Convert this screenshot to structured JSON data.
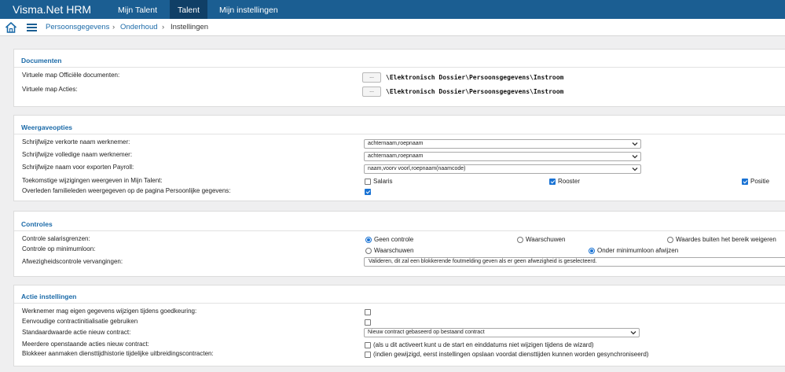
{
  "app": {
    "brand": "Visma.Net HRM",
    "nav_tabs": [
      {
        "label": "Mijn Talent",
        "active": false
      },
      {
        "label": "Talent",
        "active": true
      },
      {
        "label": "Mijn instellingen",
        "active": false
      }
    ],
    "accent_color": "#1b5e92"
  },
  "breadcrumb": {
    "items": [
      "Persoonsgegevens",
      "Onderhoud",
      "Instellingen"
    ],
    "separator": "›"
  },
  "documenten": {
    "title": "Documenten",
    "rows": [
      {
        "label": "Virtuele map Officiële documenten:",
        "button": "...",
        "path": "\\Elektronisch Dossier\\Persoonsgegevens\\Instroom"
      },
      {
        "label": "Virtuele map Acties:",
        "button": "...",
        "path": "\\Elektronisch Dossier\\Persoonsgegevens\\Instroom"
      }
    ]
  },
  "weergave": {
    "title": "Weergaveopties",
    "short_name": {
      "label": "Schrijfwijze verkorte naam werknemer:",
      "value": "achternaam,roepnaam"
    },
    "full_name": {
      "label": "Schrijfwijze volledige naam werknemer:",
      "value": "achternaam,roepnaam"
    },
    "payroll_name": {
      "label": "Schrijfwijze naam voor exporten Payroll:",
      "value": "naam,voorv voorl,roepnaam(naamcode)"
    },
    "future_changes": {
      "label": "Toekomstige wijzigingen weergeven in Mijn Talent:",
      "options": [
        {
          "label": "Salaris",
          "checked": false
        },
        {
          "label": "Rooster",
          "checked": true
        },
        {
          "label": "Positie",
          "checked": true
        }
      ]
    },
    "deceased": {
      "label": "Overleden familieleden weergegeven op de pagina Persoonlijke gegevens:",
      "checked": true
    }
  },
  "controles": {
    "title": "Controles",
    "salary": {
      "label": "Controle salarisgrenzen:",
      "options": [
        {
          "label": "Geen controle",
          "checked": true
        },
        {
          "label": "Waarschuwen",
          "checked": false
        },
        {
          "label": "Waardes buiten het bereik weigeren",
          "checked": false
        }
      ]
    },
    "minimum": {
      "label": "Controle op minimumloon:",
      "options": [
        {
          "label": "Waarschuwen",
          "checked": false
        },
        {
          "label": "Onder minimumloon afwijzen",
          "checked": true
        }
      ]
    },
    "deviation": {
      "label": "Afwezigheidscontrole vervangingen:",
      "value": "Valideren, dit zal een blokkerende foutmelding geven als er geen afwezigheid is geselecteerd."
    }
  },
  "acties": {
    "title": "Actie instellingen",
    "own_data": {
      "label": "Werknemer mag eigen gegevens wijzigen tijdens goedkeuring:",
      "checked": false
    },
    "simple_init": {
      "label": "Eenvoudige contractinitialisatie gebruiken",
      "checked": false
    },
    "default_action": {
      "label": "Standaardwaarde actie nieuw contract:",
      "value": "Nieuw contract gebaseerd op bestaand contract"
    },
    "multiple_open": {
      "label": "Meerdere openstaande acties nieuw contract:",
      "checked": false,
      "note": "(als u dit activeert kunt u de start en einddatums niet wijzigen tijdens de wizard)"
    },
    "block_history": {
      "label": "Blokkeer aanmaken diensttijdhistorie tijdelijke uitbreidingscontracten:",
      "checked": false,
      "note": "(indien gewijzigd, eerst instellingen opslaan voordat diensttijden kunnen worden gesynchroniseerd)"
    }
  }
}
